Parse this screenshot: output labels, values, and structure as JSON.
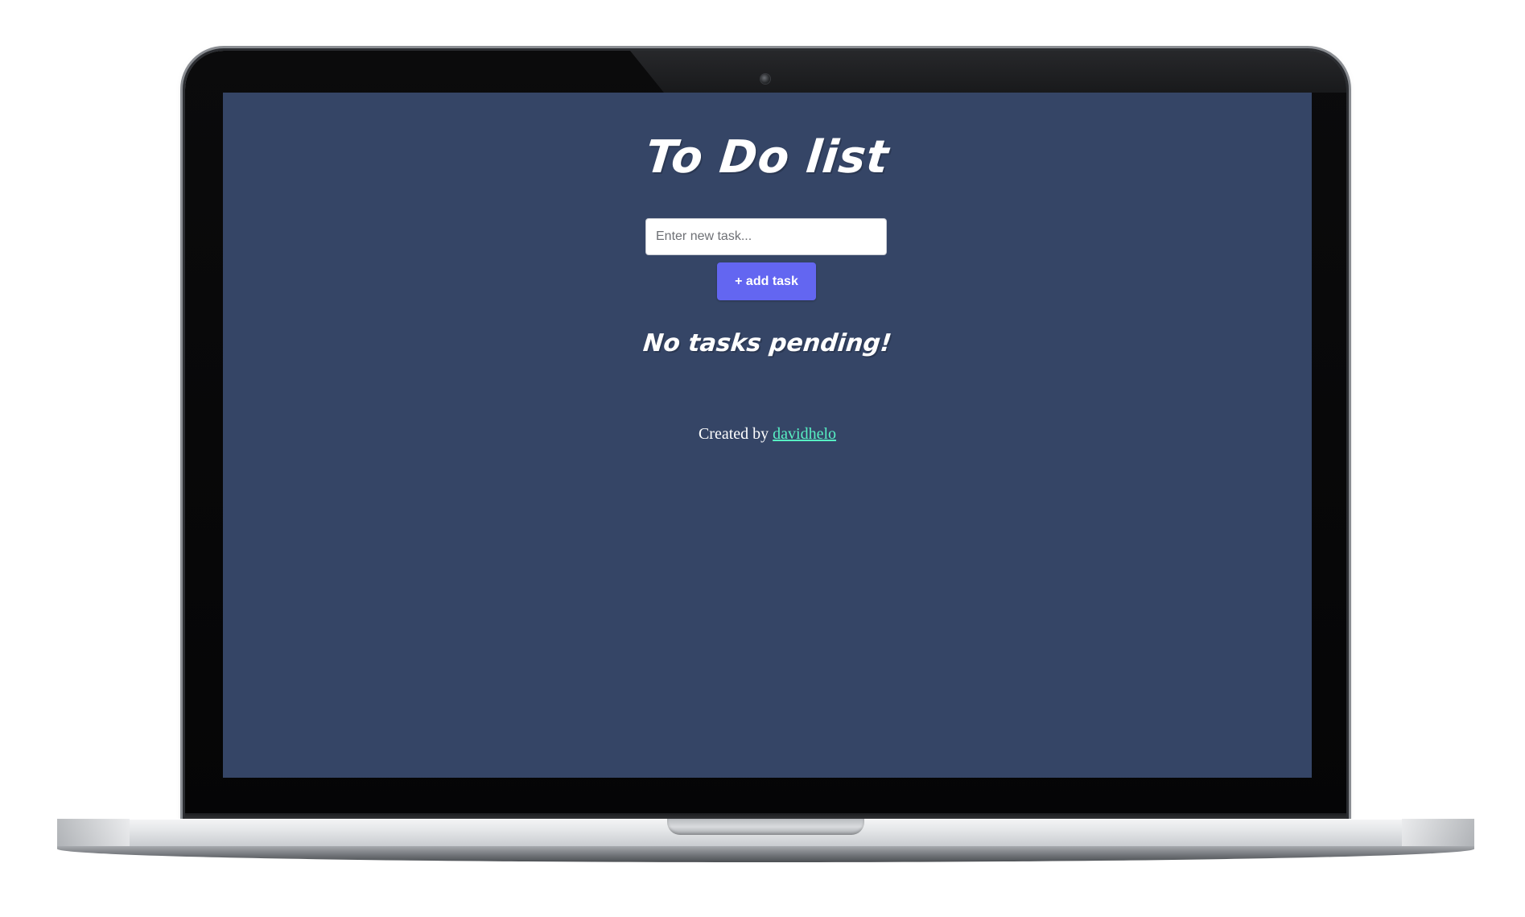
{
  "app": {
    "title": "To Do list",
    "input": {
      "value": "",
      "placeholder": "Enter new task..."
    },
    "add_button_label": "+ add task",
    "empty_message": "No tasks pending!",
    "footer": {
      "prefix": "Created by ",
      "author_link_text": "davidhelo"
    }
  },
  "colors": {
    "screen_background": "#354566",
    "button_background": "#6366f1",
    "link": "#57f0c3",
    "text": "#ffffff"
  }
}
